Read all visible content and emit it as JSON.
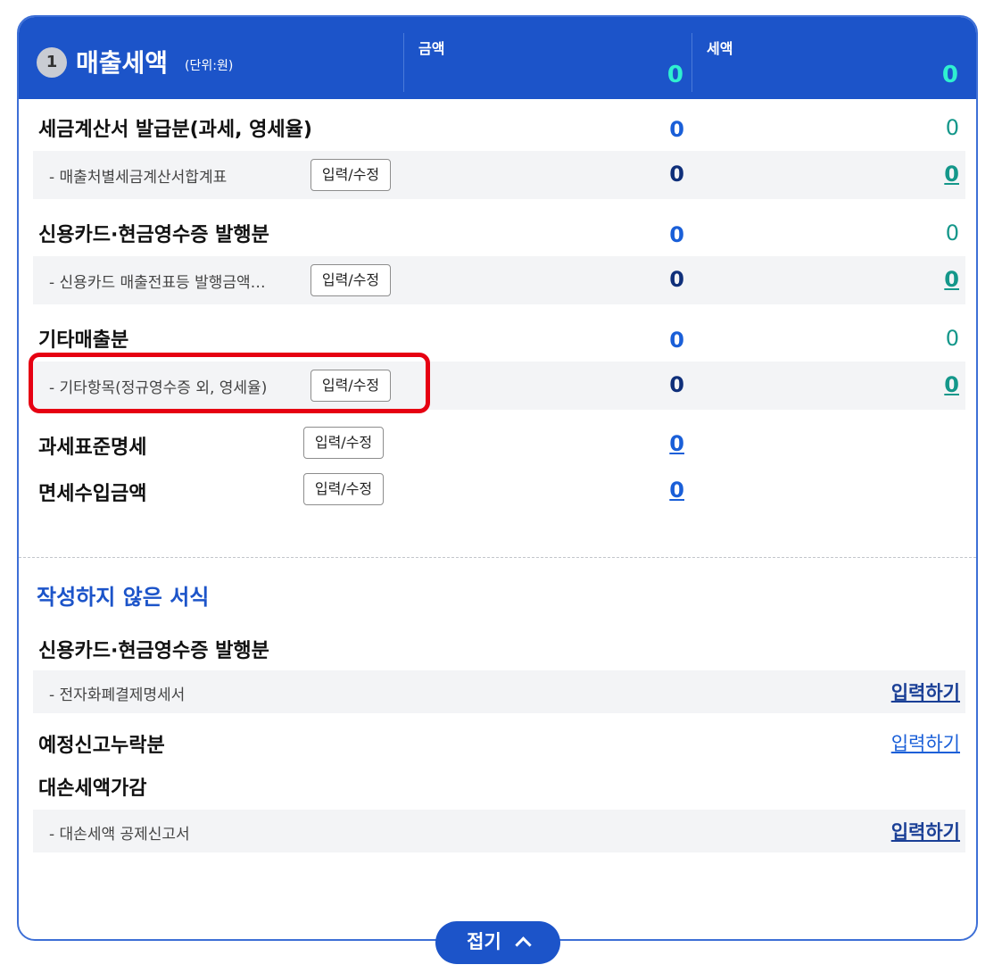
{
  "header": {
    "number": "1",
    "title": "매출세액",
    "unit": "(단위:원)",
    "col_amount_label": "금액",
    "col_tax_label": "세액",
    "total_amount": "0",
    "total_tax": "0"
  },
  "rows": {
    "tax_invoice": {
      "label": "세금계산서 발급분(과세, 영세율)",
      "amount": "0",
      "tax": "0"
    },
    "tax_invoice_sub": {
      "label": "- 매출처별세금계산서합계표",
      "button": "입력/수정",
      "amount": "0",
      "tax": "0"
    },
    "card_cash": {
      "label": "신용카드·현금영수증 발행분",
      "amount": "0",
      "tax": "0"
    },
    "card_cash_sub": {
      "label": "- 신용카드 매출전표등 발행금액…",
      "button": "입력/수정",
      "amount": "0",
      "tax": "0"
    },
    "other_sales": {
      "label": "기타매출분",
      "amount": "0",
      "tax": "0"
    },
    "other_sales_sub": {
      "label": "- 기타항목(정규영수증 외, 영세율)",
      "button": "입력/수정",
      "amount": "0",
      "tax": "0"
    },
    "tax_base": {
      "label": "과세표준명세",
      "button": "입력/수정",
      "amount": "0"
    },
    "exempt_income": {
      "label": "면세수입금액",
      "button": "입력/수정",
      "amount": "0"
    }
  },
  "unwritten": {
    "title": "작성하지 않은 서식",
    "card_cash": {
      "label": "신용카드·현금영수증 발행분"
    },
    "card_cash_sub": {
      "label": "- 전자화폐결제명세서",
      "link": "입력하기"
    },
    "missed_preliminary": {
      "label": "예정신고누락분",
      "link": "입력하기"
    },
    "bad_debt": {
      "label": "대손세액가감"
    },
    "bad_debt_sub": {
      "label": "- 대손세액 공제신고서",
      "link": "입력하기"
    }
  },
  "fold_button": "접기",
  "colors": {
    "header_bg": "#1c54c9",
    "highlight": "#e60012",
    "total_value": "#2ff0d0"
  }
}
